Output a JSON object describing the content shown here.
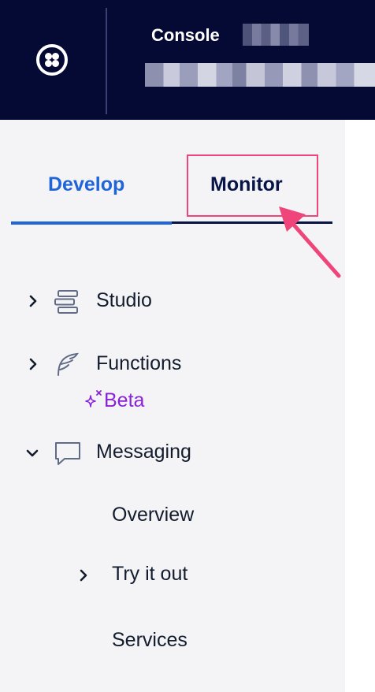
{
  "header": {
    "title": "Console",
    "logo_icon": "twilio-logo-icon"
  },
  "tabs": [
    {
      "label": "Develop",
      "active": true,
      "color": "#1f64d8"
    },
    {
      "label": "Monitor",
      "active": false,
      "highlighted": true,
      "color": "#061448"
    }
  ],
  "annotation": {
    "color": "#f0457a",
    "icon": "pointer-arrow-icon"
  },
  "nav": {
    "items": [
      {
        "label": "Studio",
        "icon": "studio-icon",
        "expanded": false
      },
      {
        "label": "Functions",
        "icon": "functions-icon",
        "expanded": false,
        "badge": "Beta",
        "badge_icon": "sparkle-icon"
      },
      {
        "label": "Messaging",
        "icon": "chat-icon",
        "expanded": true
      }
    ],
    "sub_items": [
      {
        "label": "Overview"
      },
      {
        "label": "Try it out",
        "has_children": true
      },
      {
        "label": "Services"
      }
    ]
  }
}
